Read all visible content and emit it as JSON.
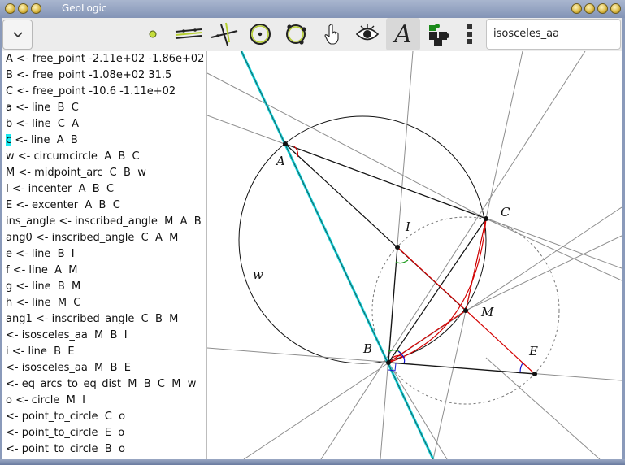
{
  "window": {
    "title": "GeoLogic"
  },
  "toolbar": {
    "tools": [
      {
        "name": "menu-button",
        "icon": "chevron-down-icon"
      },
      {
        "name": "point-tool",
        "icon": "point-icon"
      },
      {
        "name": "parallel-tool",
        "icon": "parallel-lines-icon"
      },
      {
        "name": "perpendicular-tool",
        "icon": "perpendicular-icon"
      },
      {
        "name": "circle-center-tool",
        "icon": "circle-center-icon"
      },
      {
        "name": "circle-points-tool",
        "icon": "circle-three-points-icon"
      },
      {
        "name": "move-tool",
        "icon": "hand-pointer-icon"
      },
      {
        "name": "hide-tool",
        "icon": "eye-icon"
      },
      {
        "name": "label-tool",
        "icon": "letter-a-icon",
        "label": "A"
      },
      {
        "name": "reason-tool",
        "icon": "puzzle-icon"
      },
      {
        "name": "more-tool",
        "icon": "vertical-dots-icon"
      }
    ],
    "command_value": "isosceles_aa"
  },
  "commands": [
    {
      "text": "A <- free_point -2.11e+02 -1.86e+02"
    },
    {
      "text": "B <- free_point -1.08e+02 31.5"
    },
    {
      "text": "C <- free_point -10.6 -1.11e+02"
    },
    {
      "text": "a <- line  B  C"
    },
    {
      "text": "b <- line  C  A"
    },
    {
      "highlight": "c",
      "text": " <- line  A  B"
    },
    {
      "text": "w <- circumcircle  A  B  C"
    },
    {
      "text": "M <- midpoint_arc  C  B  w"
    },
    {
      "text": "I <- incenter  A  B  C"
    },
    {
      "text": "E <- excenter  A  B  C"
    },
    {
      "text": "ins_angle <- inscribed_angle  M  A  B"
    },
    {
      "text": "ang0 <- inscribed_angle  C  A  M"
    },
    {
      "text": "e <- line  B  I"
    },
    {
      "text": "f <- line  A  M"
    },
    {
      "text": "g <- line  B  M"
    },
    {
      "text": "h <- line  M  C"
    },
    {
      "text": "ang1 <- inscribed_angle  C  B  M"
    },
    {
      "text": "<- isosceles_aa  M  B  I"
    },
    {
      "text": "i <- line  B  E"
    },
    {
      "text": "<- isosceles_aa  M  B  E"
    },
    {
      "text": "<- eq_arcs_to_eq_dist  M  B  C  M  w"
    },
    {
      "text": "o <- circle  M  I"
    },
    {
      "text": "<- point_to_circle  C  o"
    },
    {
      "text": "<- point_to_circle  E  o"
    },
    {
      "text": "<- point_to_circle  B  o"
    }
  ],
  "canvas": {
    "labels": {
      "A": "A",
      "B": "B",
      "C": "C",
      "I": "I",
      "M": "M",
      "E": "E",
      "w": "w"
    },
    "colors": {
      "highlight_line": "#19d3db",
      "red": "#d40000",
      "green": "#1a9a1a",
      "blue": "#1010d0",
      "gray": "#888888"
    }
  }
}
